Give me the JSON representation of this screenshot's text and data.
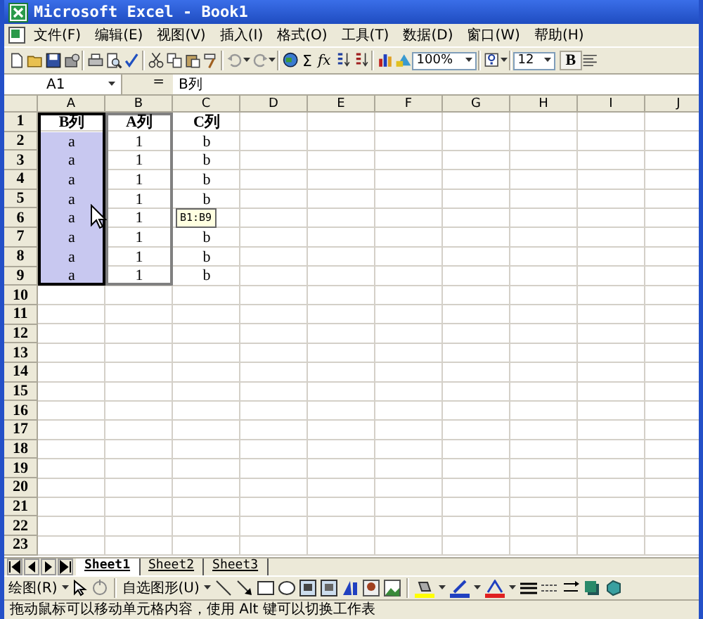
{
  "window": {
    "title": "Microsoft Excel - Book1"
  },
  "menu": [
    "文件(F)",
    "编辑(E)",
    "视图(V)",
    "插入(I)",
    "格式(O)",
    "工具(T)",
    "数据(D)",
    "窗口(W)",
    "帮助(H)"
  ],
  "toolbar": {
    "autosum": "Σ",
    "function": "fx",
    "zoom": "100%",
    "font_size": "12",
    "bold": "B"
  },
  "formula_bar": {
    "name_box": "A1",
    "equals": "=",
    "value": "B列"
  },
  "columns": [
    "A",
    "B",
    "C",
    "D",
    "E",
    "F",
    "G",
    "H",
    "I",
    "J"
  ],
  "rows": [
    {
      "header": "1",
      "cells": [
        {
          "value": "B列",
          "selected": true,
          "active": true,
          "drag_target": false
        },
        {
          "value": "A列",
          "selected": false,
          "drag_target": true
        },
        {
          "value": "C列",
          "selected": false,
          "drag_target": false
        }
      ]
    },
    {
      "header": "2",
      "cells": [
        {
          "value": "a",
          "selected": true,
          "active": false,
          "drag_target": false
        },
        {
          "value": "1",
          "selected": false,
          "drag_target": true
        },
        {
          "value": "b",
          "selected": false,
          "drag_target": false
        }
      ]
    },
    {
      "header": "3",
      "cells": [
        {
          "value": "a",
          "selected": true,
          "active": false,
          "drag_target": false
        },
        {
          "value": "1",
          "selected": false,
          "drag_target": true
        },
        {
          "value": "b",
          "selected": false,
          "drag_target": false
        }
      ]
    },
    {
      "header": "4",
      "cells": [
        {
          "value": "a",
          "selected": true,
          "active": false,
          "drag_target": false
        },
        {
          "value": "1",
          "selected": false,
          "drag_target": true
        },
        {
          "value": "b",
          "selected": false,
          "drag_target": false
        }
      ]
    },
    {
      "header": "5",
      "cells": [
        {
          "value": "a",
          "selected": true,
          "active": false,
          "drag_target": false
        },
        {
          "value": "1",
          "selected": false,
          "drag_target": true
        },
        {
          "value": "b",
          "selected": false,
          "drag_target": false
        }
      ]
    },
    {
      "header": "6",
      "cells": [
        {
          "value": "a",
          "selected": true,
          "active": false,
          "drag_target": false
        },
        {
          "value": "1",
          "selected": false,
          "drag_target": true
        },
        {
          "tooltip": "B1:B9",
          "selected": false,
          "drag_target": false
        }
      ]
    },
    {
      "header": "7",
      "cells": [
        {
          "value": "a",
          "selected": true,
          "active": false,
          "drag_target": false
        },
        {
          "value": "1",
          "selected": false,
          "drag_target": true
        },
        {
          "value": "b",
          "selected": false,
          "drag_target": false
        }
      ]
    },
    {
      "header": "8",
      "cells": [
        {
          "value": "a",
          "selected": true,
          "active": false,
          "drag_target": false
        },
        {
          "value": "1",
          "selected": false,
          "drag_target": true
        },
        {
          "value": "b",
          "selected": false,
          "drag_target": false
        }
      ]
    },
    {
      "header": "9",
      "cells": [
        {
          "value": "a",
          "selected": true,
          "active": false,
          "drag_target": false
        },
        {
          "value": "1",
          "selected": false,
          "drag_target": true
        },
        {
          "value": "b",
          "selected": false,
          "drag_target": false
        }
      ]
    },
    {
      "header": "10"
    },
    {
      "header": "11"
    },
    {
      "header": "12"
    },
    {
      "header": "13"
    },
    {
      "header": "14"
    },
    {
      "header": "15"
    },
    {
      "header": "16"
    },
    {
      "header": "17"
    },
    {
      "header": "18"
    },
    {
      "header": "19"
    },
    {
      "header": "20"
    },
    {
      "header": "21"
    },
    {
      "header": "22"
    },
    {
      "header": "23"
    }
  ],
  "sheet_tabs": [
    {
      "label": "Sheet1",
      "selected": true
    },
    {
      "label": "Sheet2",
      "selected": false
    },
    {
      "label": "Sheet3",
      "selected": false
    }
  ],
  "drawing_toolbar": {
    "draw_menu": "绘图(R)",
    "autoshapes_menu": "自选图形(U)"
  },
  "status_bar": "拖动鼠标可以移动单元格内容，使用 Alt 键可以切换工作表"
}
